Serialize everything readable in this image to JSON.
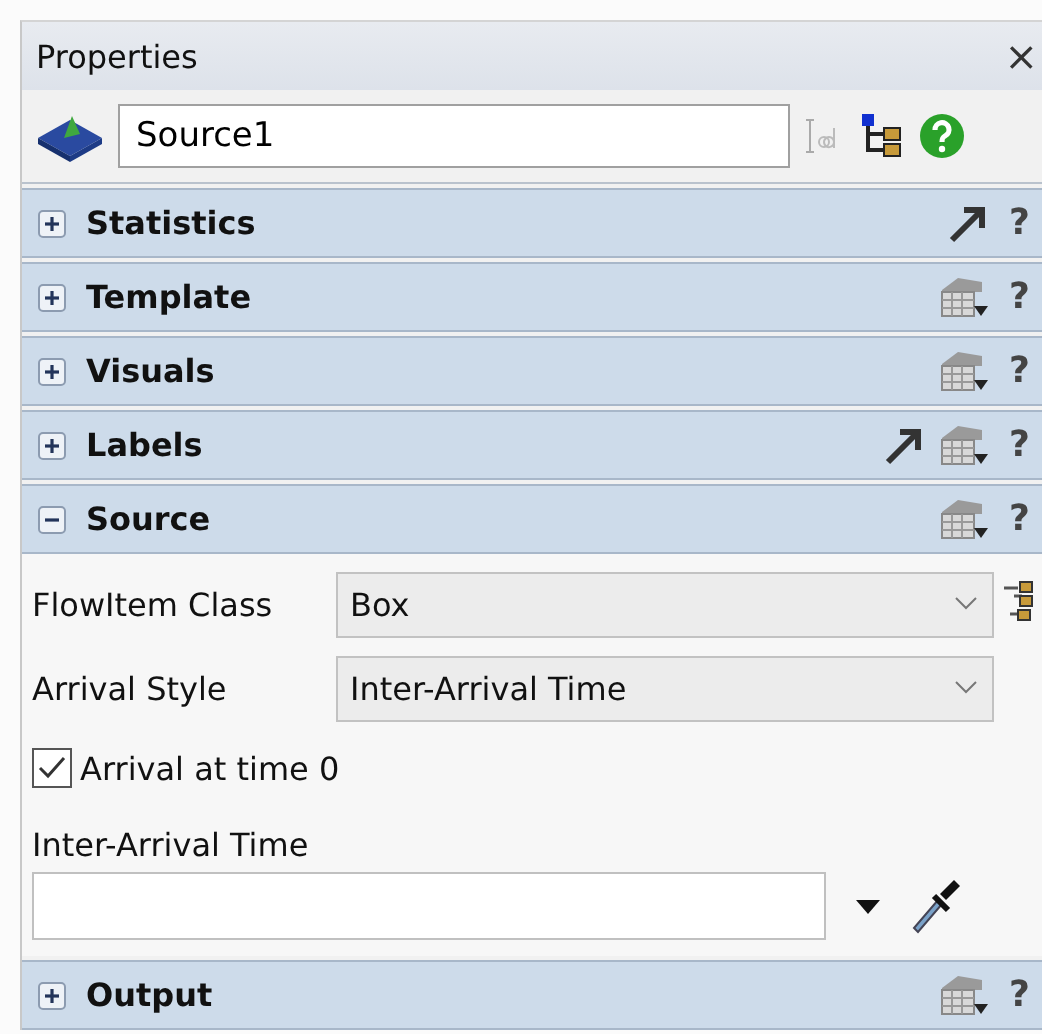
{
  "window": {
    "title": "Properties",
    "close": "×"
  },
  "object": {
    "name": "Source1"
  },
  "sections": [
    {
      "title": "Statistics",
      "expanded": false,
      "link_button": true,
      "template_button": false,
      "help": "?"
    },
    {
      "title": "Template",
      "expanded": false,
      "link_button": false,
      "template_button": true,
      "help": "?"
    },
    {
      "title": "Visuals",
      "expanded": false,
      "link_button": false,
      "template_button": true,
      "help": "?"
    },
    {
      "title": "Labels",
      "expanded": false,
      "link_button": true,
      "template_button": true,
      "help": "?"
    },
    {
      "title": "Source",
      "expanded": true,
      "link_button": false,
      "template_button": true,
      "help": "?",
      "fields": [
        {
          "kind": "dropdown",
          "label": "FlowItem Class",
          "value": "Box",
          "tree_button": true
        },
        {
          "kind": "dropdown",
          "label": "Arrival Style",
          "value": "Inter-Arrival Time",
          "tree_button": false
        },
        {
          "kind": "checkbox",
          "label": "Arrival at time 0",
          "checked": true
        },
        {
          "kind": "textfield",
          "label": "Inter-Arrival Time"
        }
      ]
    },
    {
      "title": "Output",
      "expanded": false,
      "link_button": false,
      "template_button": true,
      "help": "?"
    }
  ]
}
